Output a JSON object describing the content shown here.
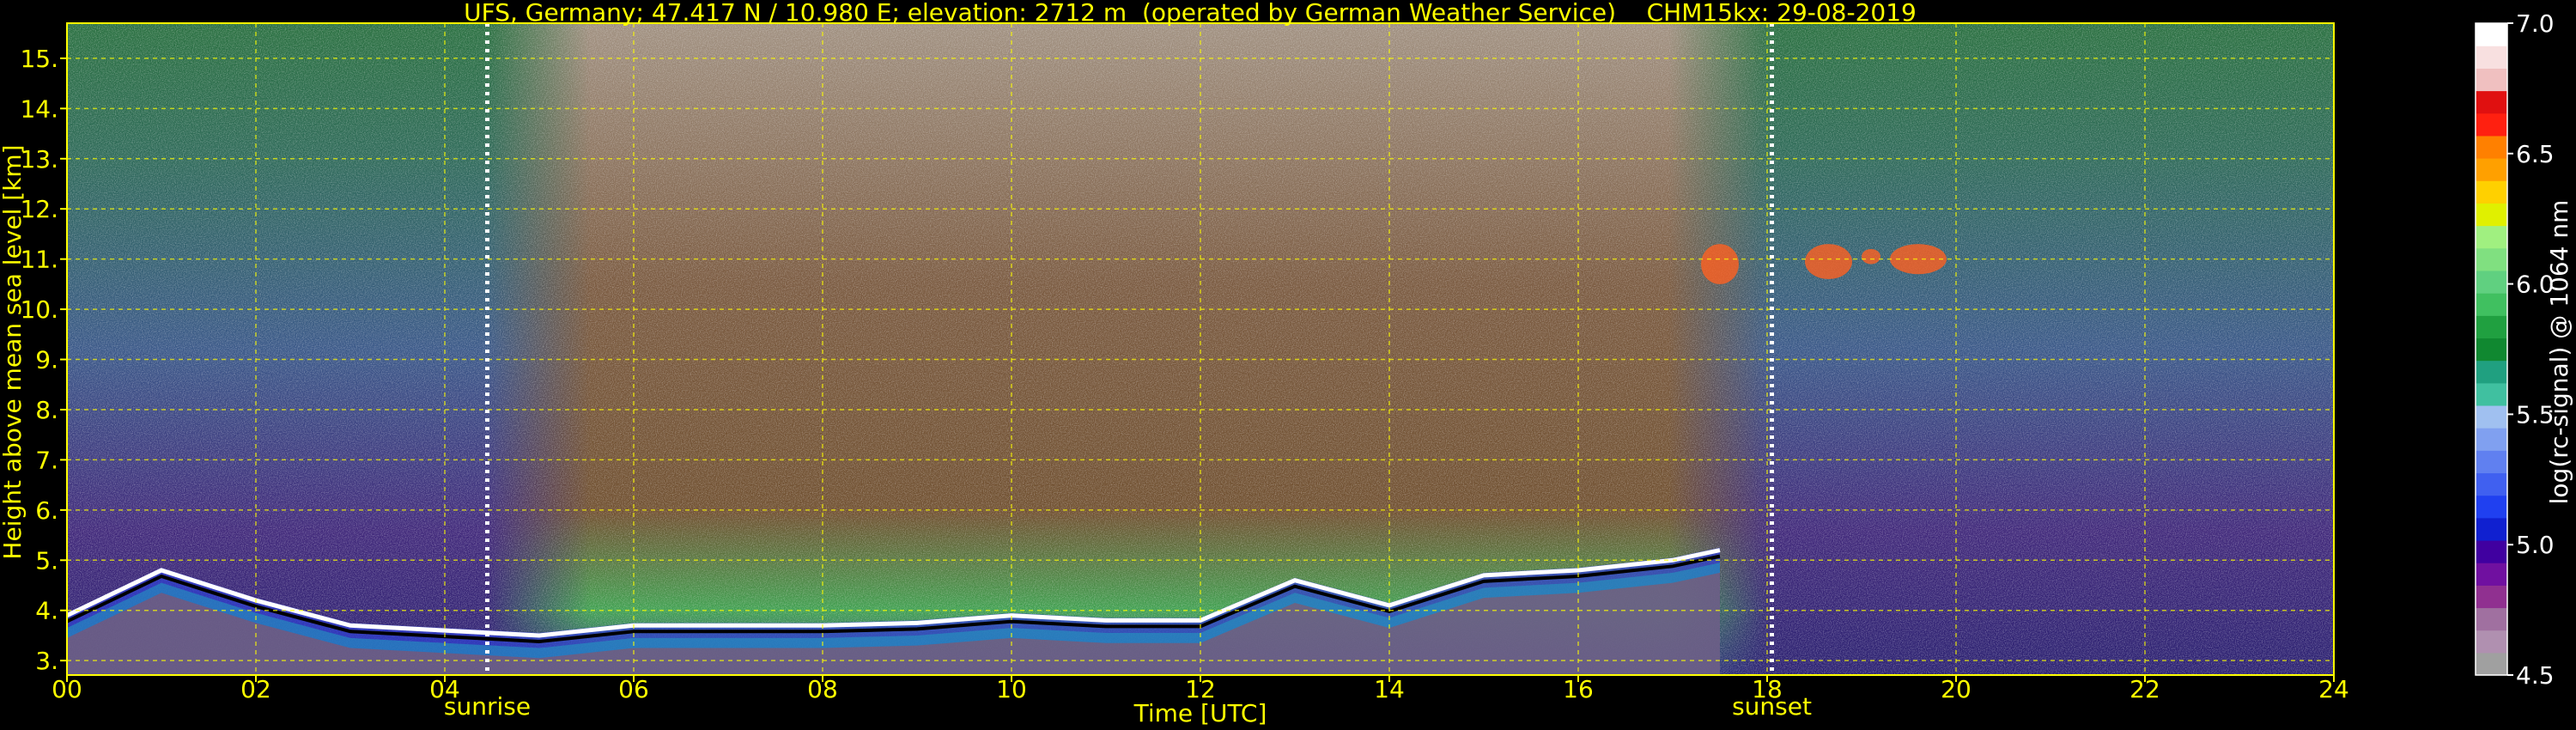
{
  "chart_data": {
    "type": "heatmap",
    "title": "UFS, Germany; 47.417 N / 10.980 E; elevation: 2712 m  (operated by German Weather Service)    CHM15kx: 29-08-2019",
    "xlabel": "Time [UTC]",
    "ylabel": "Height above mean sea level [km]",
    "xlim": [
      0,
      24
    ],
    "ylim": [
      2.712,
      15.7
    ],
    "x_ticks": [
      "00",
      "02",
      "04",
      "06",
      "08",
      "10",
      "12",
      "14",
      "16",
      "18",
      "20",
      "22",
      "24"
    ],
    "y_ticks": [
      "3.",
      "4.",
      "5.",
      "6.",
      "7.",
      "8.",
      "9.",
      "10.",
      "11.",
      "12.",
      "13.",
      "14.",
      "15."
    ],
    "grid": true,
    "grid_color": "#ffff00",
    "events": [
      {
        "label": "sunrise",
        "time": 4.45
      },
      {
        "label": "sunset",
        "time": 18.05
      }
    ],
    "colorbar": {
      "label": "log(rc-signal) @ 1064 nm",
      "range": [
        4.5,
        7.0
      ],
      "ticks": [
        "7.0",
        "6.5",
        "6.0",
        "5.5",
        "5.0",
        "4.5"
      ],
      "colors": [
        "#a0a0a0",
        "#b090b0",
        "#a070a0",
        "#903090",
        "#7010a0",
        "#4000a0",
        "#1020d0",
        "#2040f0",
        "#4060f0",
        "#6080f0",
        "#80a0f0",
        "#a0c0f0",
        "#40c0a0",
        "#20a080",
        "#108830",
        "#20a040",
        "#40c060",
        "#60d080",
        "#80e080",
        "#a0f080",
        "#e0f000",
        "#ffd000",
        "#ffa000",
        "#ff8000",
        "#ff2010",
        "#e01010",
        "#f0c0c0",
        "#f8e0e0",
        "#ffffff"
      ]
    },
    "series": [
      {
        "values": [
          [
            0,
            3.9
          ],
          [
            1,
            4.8
          ],
          [
            2,
            4.2
          ],
          [
            3,
            3.7
          ],
          [
            4,
            3.6
          ],
          [
            5,
            3.5
          ],
          [
            6,
            3.7
          ],
          [
            7,
            3.7
          ],
          [
            8,
            3.7
          ],
          [
            9,
            3.75
          ],
          [
            10,
            3.9
          ],
          [
            11,
            3.8
          ],
          [
            12,
            3.8
          ],
          [
            13,
            4.6
          ],
          [
            14,
            4.1
          ],
          [
            15,
            4.7
          ],
          [
            16,
            4.8
          ],
          [
            17,
            5.0
          ],
          [
            17.5,
            5.2
          ]
        ]
      }
    ],
    "cirrus_patches": [
      {
        "t_start": 17.3,
        "t_end": 17.7,
        "h_top": 11.3,
        "h_bottom": 10.5
      },
      {
        "t_start": 18.4,
        "t_end": 18.9,
        "h_top": 11.3,
        "h_bottom": 10.6
      },
      {
        "t_start": 19.0,
        "t_end": 19.2,
        "h_top": 11.2,
        "h_bottom": 10.9
      },
      {
        "t_start": 19.3,
        "t_end": 19.9,
        "h_top": 11.3,
        "h_bottom": 10.7
      }
    ],
    "colors": {
      "background": "#000000",
      "text": "#ffff00",
      "colorbar_text": "#ffffff"
    }
  }
}
